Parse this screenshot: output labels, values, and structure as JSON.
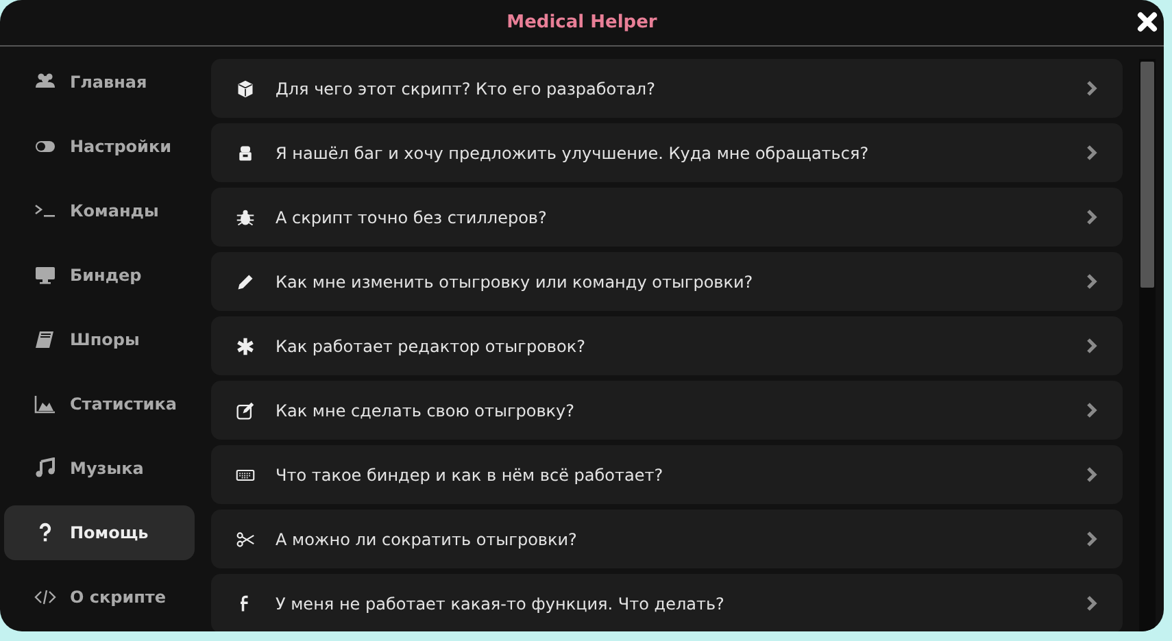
{
  "window": {
    "title": "Medical Helper"
  },
  "sidebar": {
    "items": [
      {
        "label": "Главная",
        "selected": false
      },
      {
        "label": "Настройки",
        "selected": false
      },
      {
        "label": "Команды",
        "selected": false
      },
      {
        "label": "Биндер",
        "selected": false
      },
      {
        "label": "Шпоры",
        "selected": false
      },
      {
        "label": "Статистика",
        "selected": false
      },
      {
        "label": "Музыка",
        "selected": false
      },
      {
        "label": "Помощь",
        "selected": true
      },
      {
        "label": "О скрипте",
        "selected": false
      }
    ]
  },
  "faq": [
    {
      "question": "Для чего этот скрипт? Кто его разработал?"
    },
    {
      "question": "Я нашёл баг и хочу предложить улучшение. Куда мне обращаться?"
    },
    {
      "question": "А скрипт точно без стиллеров?"
    },
    {
      "question": "Как мне изменить отыгровку или команду отыгровки?"
    },
    {
      "question": "Как работает редактор отыгровок?"
    },
    {
      "question": "Как мне сделать свою отыгровку?"
    },
    {
      "question": "Что такое биндер и как в нём всё работает?"
    },
    {
      "question": "А можно ли сократить отыгровки?"
    },
    {
      "question": "У меня не работает какая-то функция. Что делать?"
    }
  ]
}
